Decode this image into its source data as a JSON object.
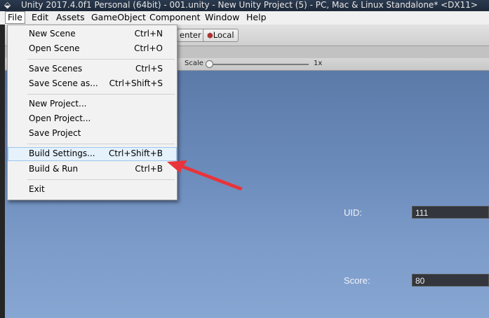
{
  "window": {
    "logo_icon": "unity-logo-icon",
    "title": "Unity 2017.4.0f1 Personal (64bit) - 001.unity - New Unity Project (5) - PC, Mac & Linux Standalone* <DX11>"
  },
  "menubar": {
    "items": [
      "File",
      "Edit",
      "Assets",
      "GameObject",
      "Component",
      "Window",
      "Help"
    ]
  },
  "toolbar": {
    "center_label": "enter",
    "local_label": "Local",
    "local_icon": "cube-icon"
  },
  "gamebar": {
    "scale_label": "Scale",
    "scale_value": "1x"
  },
  "file_menu": {
    "items": [
      {
        "label": "New Scene",
        "shortcut": "Ctrl+N"
      },
      {
        "label": "Open Scene",
        "shortcut": "Ctrl+O"
      },
      {
        "label": "Save Scenes",
        "shortcut": "Ctrl+S"
      },
      {
        "label": "Save Scene as...",
        "shortcut": "Ctrl+Shift+S"
      },
      {
        "label": "New Project...",
        "shortcut": ""
      },
      {
        "label": "Open Project...",
        "shortcut": ""
      },
      {
        "label": "Save Project",
        "shortcut": ""
      },
      {
        "label": "Build Settings...",
        "shortcut": "Ctrl+Shift+B"
      },
      {
        "label": "Build & Run",
        "shortcut": "Ctrl+B"
      },
      {
        "label": "Exit",
        "shortcut": ""
      }
    ],
    "highlighted": "Build Settings..."
  },
  "game": {
    "uid_label": "UID:",
    "uid_value": "111",
    "score_label": "Score:",
    "score_value": "80"
  },
  "annotation": {
    "arrow_color": "#e8343a"
  }
}
